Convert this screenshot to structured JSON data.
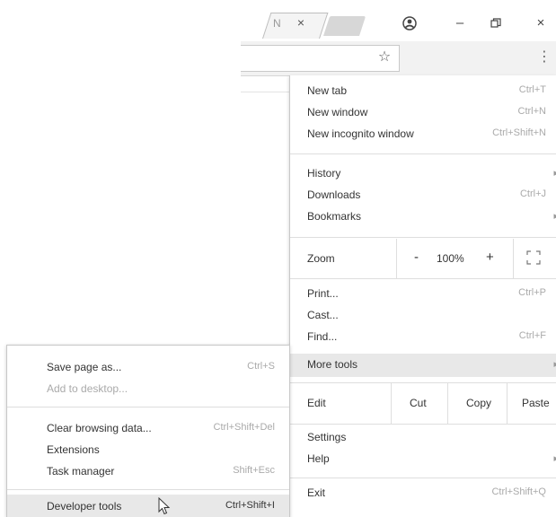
{
  "tabbar": {
    "active_tab_label": "N",
    "close_glyph": "×",
    "window_icons": [
      "profile-icon",
      "minimize-icon",
      "restore-icon",
      "close-icon"
    ],
    "minimize_glyph": "–",
    "close_window_glyph": "×"
  },
  "toolbar": {
    "icons": [
      "star-icon",
      "kebab-menu-icon"
    ]
  },
  "menu": {
    "items": {
      "new_tab": {
        "label": "New tab",
        "shortcut": "Ctrl+T"
      },
      "new_window": {
        "label": "New window",
        "shortcut": "Ctrl+N"
      },
      "new_incognito": {
        "label": "New incognito window",
        "shortcut": "Ctrl+Shift+N"
      },
      "history": {
        "label": "History"
      },
      "downloads": {
        "label": "Downloads",
        "shortcut": "Ctrl+J"
      },
      "bookmarks": {
        "label": "Bookmarks"
      },
      "print": {
        "label": "Print...",
        "shortcut": "Ctrl+P"
      },
      "cast": {
        "label": "Cast..."
      },
      "find": {
        "label": "Find...",
        "shortcut": "Ctrl+F"
      },
      "more_tools": {
        "label": "More tools"
      },
      "settings": {
        "label": "Settings"
      },
      "help": {
        "label": "Help"
      },
      "exit": {
        "label": "Exit",
        "shortcut": "Ctrl+Shift+Q"
      }
    },
    "zoom": {
      "label": "Zoom",
      "minus": "-",
      "value": "100%",
      "plus": "+"
    },
    "edit": {
      "label": "Edit",
      "cut": "Cut",
      "copy": "Copy",
      "paste": "Paste"
    }
  },
  "submenu": {
    "save_page": {
      "label": "Save page as...",
      "shortcut": "Ctrl+S"
    },
    "add_to_desktop": {
      "label": "Add to desktop..."
    },
    "clear_browsing": {
      "label": "Clear browsing data...",
      "shortcut": "Ctrl+Shift+Del"
    },
    "extensions": {
      "label": "Extensions"
    },
    "task_manager": {
      "label": "Task manager",
      "shortcut": "Shift+Esc"
    },
    "developer_tools": {
      "label": "Developer tools",
      "shortcut": "Ctrl+Shift+I"
    }
  }
}
